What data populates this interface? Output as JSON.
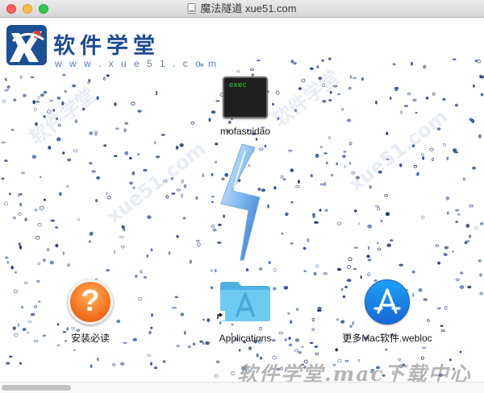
{
  "window": {
    "title": "魔法隧道 xue51.com"
  },
  "logo": {
    "brand": "软件学堂",
    "url": "w w w . x u e 5 1 . c o m"
  },
  "watermarks": [
    "软件学堂",
    "xue51.com",
    "软件学堂",
    "xue51.com"
  ],
  "items": {
    "exec": {
      "label": "mofasuidao",
      "badge": "exec"
    },
    "help": {
      "label": "安装必读",
      "symbol": "?"
    },
    "applications": {
      "label": "Applications"
    },
    "store": {
      "label": "更多Mac软件.webloc"
    }
  },
  "footer": {
    "watermark": "软件学堂.mac下载中心"
  },
  "colors": {
    "accent": "#1c4b92",
    "help_orange": "#f57320",
    "store_blue": "#1ba1f5",
    "folder_blue": "#5cc0ee"
  }
}
